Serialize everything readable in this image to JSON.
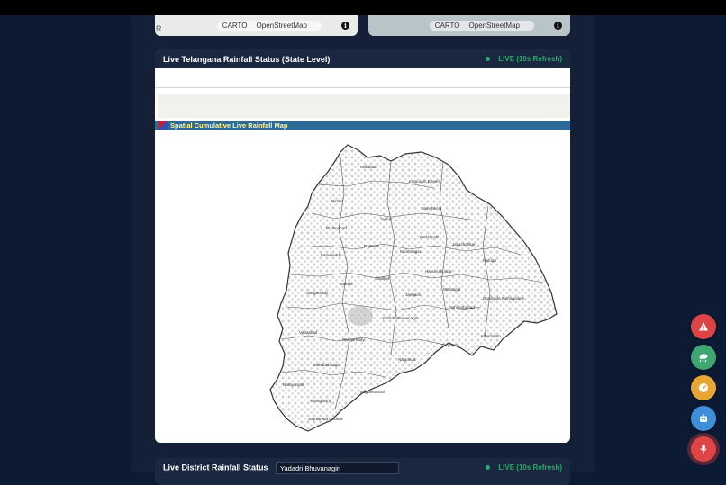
{
  "mini_maps": {
    "left": {
      "attribution": [
        "CARTO",
        "OpenStreetMap"
      ],
      "edge_letter": "R"
    },
    "right": {
      "attribution": [
        "CARTO",
        "OpenStreetMap"
      ]
    }
  },
  "state_panel": {
    "title": "Live Telangana Rainfall Status (State Level)",
    "live_label": "LIVE (10s Refresh)",
    "map_title": "Spatial Cumulative Live Rainfall Map",
    "districts": [
      "Adilabad",
      "Kumuram Bheem",
      "Mancherial",
      "Nirmal",
      "Jagtial",
      "Peddapalli",
      "Jayashankar",
      "Mulugu",
      "Nizamabad",
      "Kamareddy",
      "Rajanna",
      "Karimnagar",
      "Hanumakonda",
      "Warangal",
      "Medak",
      "Siddipet",
      "Jangaon",
      "Sangareddy",
      "Mahabubabad",
      "Bhadradri Kothagudem",
      "Vikarabad",
      "Yadadri Bhuvanagiri",
      "Suryapet",
      "Khammam",
      "Rangareddy",
      "Nalgonda",
      "Mahabubnagar",
      "Narayanpet",
      "Nagarkurnool",
      "Wanaparthy",
      "Jogulamba Gadwal"
    ]
  },
  "district_panel": {
    "title": "Live District Rainfall Status",
    "selected_district": "Yadadri Bhuvanagiri",
    "live_label": "LIVE (10s Refresh)"
  },
  "fab_buttons": [
    "warning-icon",
    "rain-cloud-icon",
    "gauge-icon",
    "robot-icon",
    "microphone-icon"
  ],
  "colors": {
    "background": "#0c1a33",
    "live_green": "#2ea86a",
    "map_title_bar": "#2d6a98",
    "map_title_text": "#fff7a0"
  }
}
